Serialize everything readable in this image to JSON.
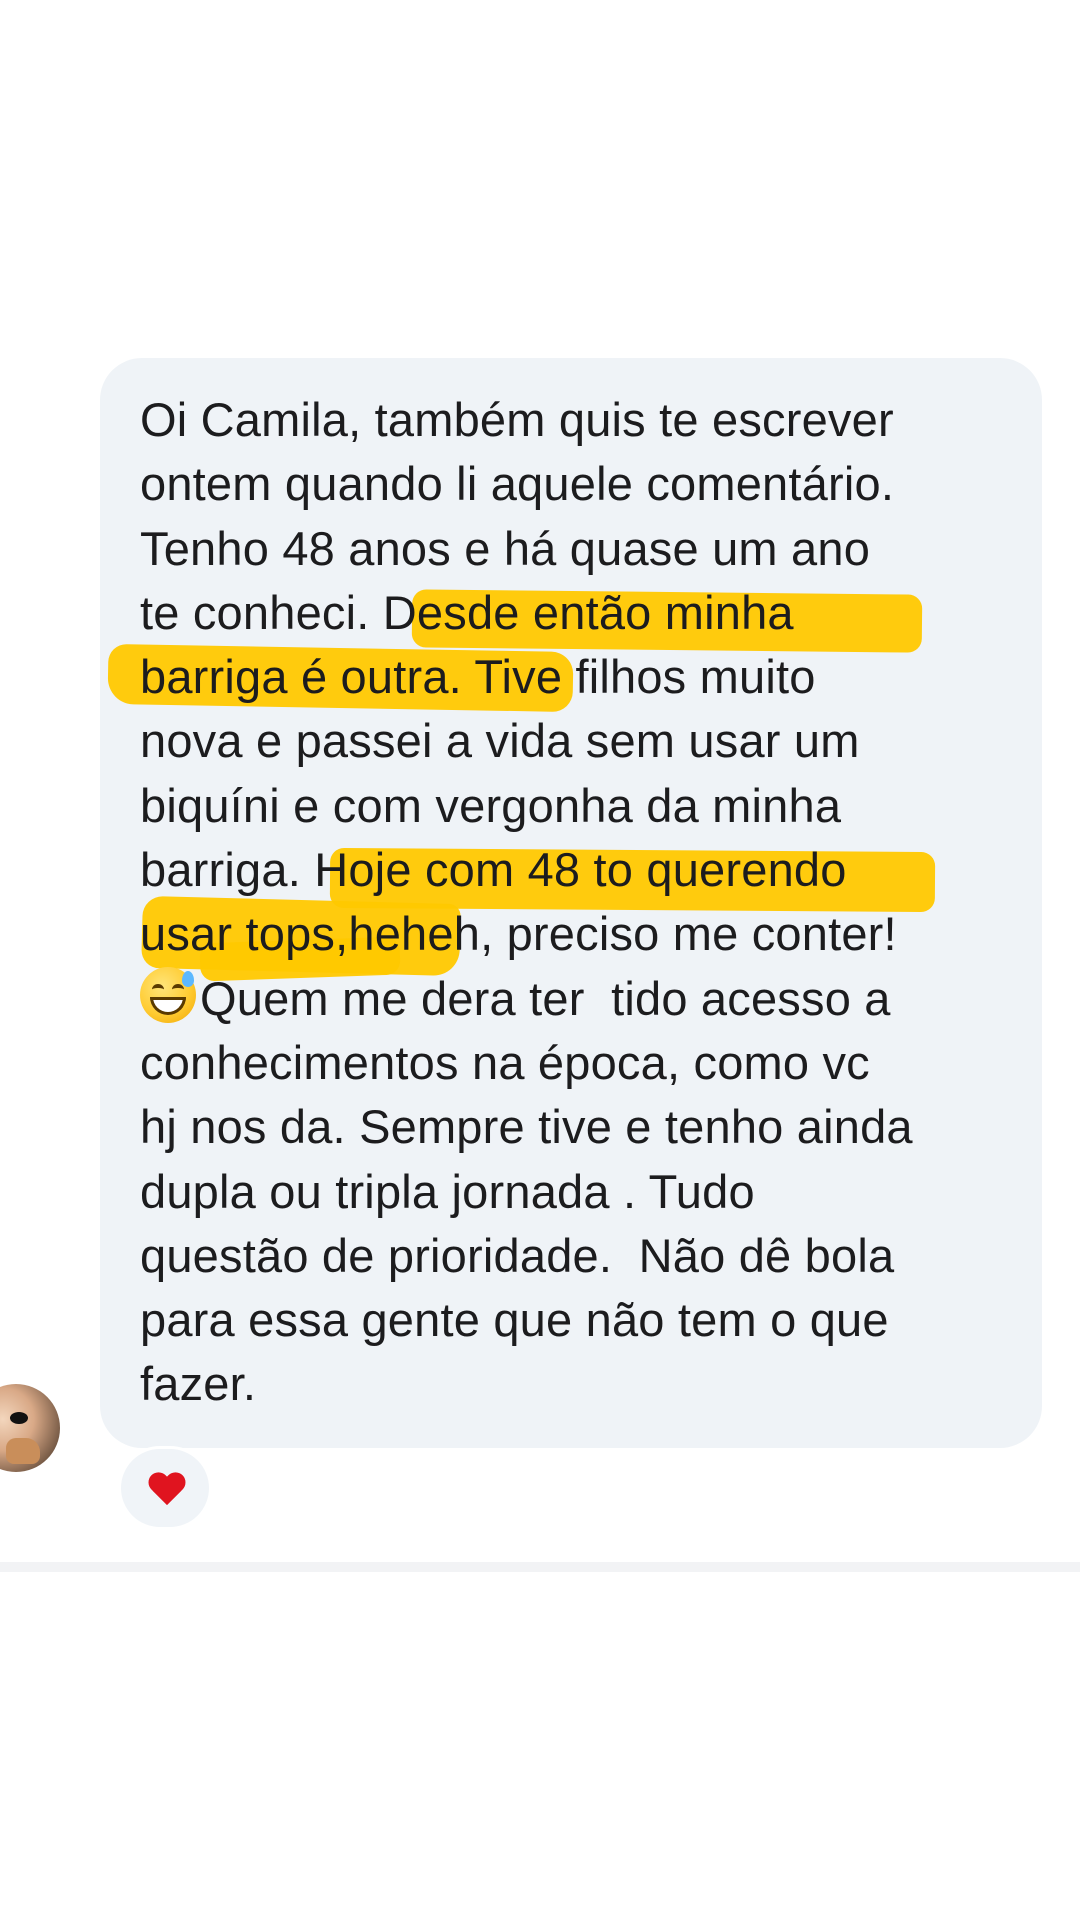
{
  "message": {
    "lines": [
      "Oi Camila, também quis te escrever",
      "ontem quando li aquele comentário.",
      "Tenho 48 anos e há quase um ano",
      "te conheci. Desde então minha",
      "barriga é outra. Tive filhos muito",
      "nova e passei a vida sem usar um",
      "biquíni e com vergonha da minha",
      "barriga. Hoje com 48 to querendo",
      "usar tops,heheh, preciso me conter!",
      "Quem me dera ter  tido acesso a",
      "conhecimentos na época, como vc",
      "hj nos da. Sempre tive e tenho ainda",
      "dupla ou tripla jornada . Tudo",
      "questão de prioridade.  Não dê bola",
      "para essa gente que não tem o que",
      "fazer."
    ],
    "emoji": "grinning-face-with-sweat",
    "highlight_color": "#ffc800",
    "bubble_color": "#eff3f7"
  },
  "reaction": {
    "icon": "red-heart",
    "color": "#e0141f"
  },
  "sender": {
    "avatar": "profile-photo"
  }
}
